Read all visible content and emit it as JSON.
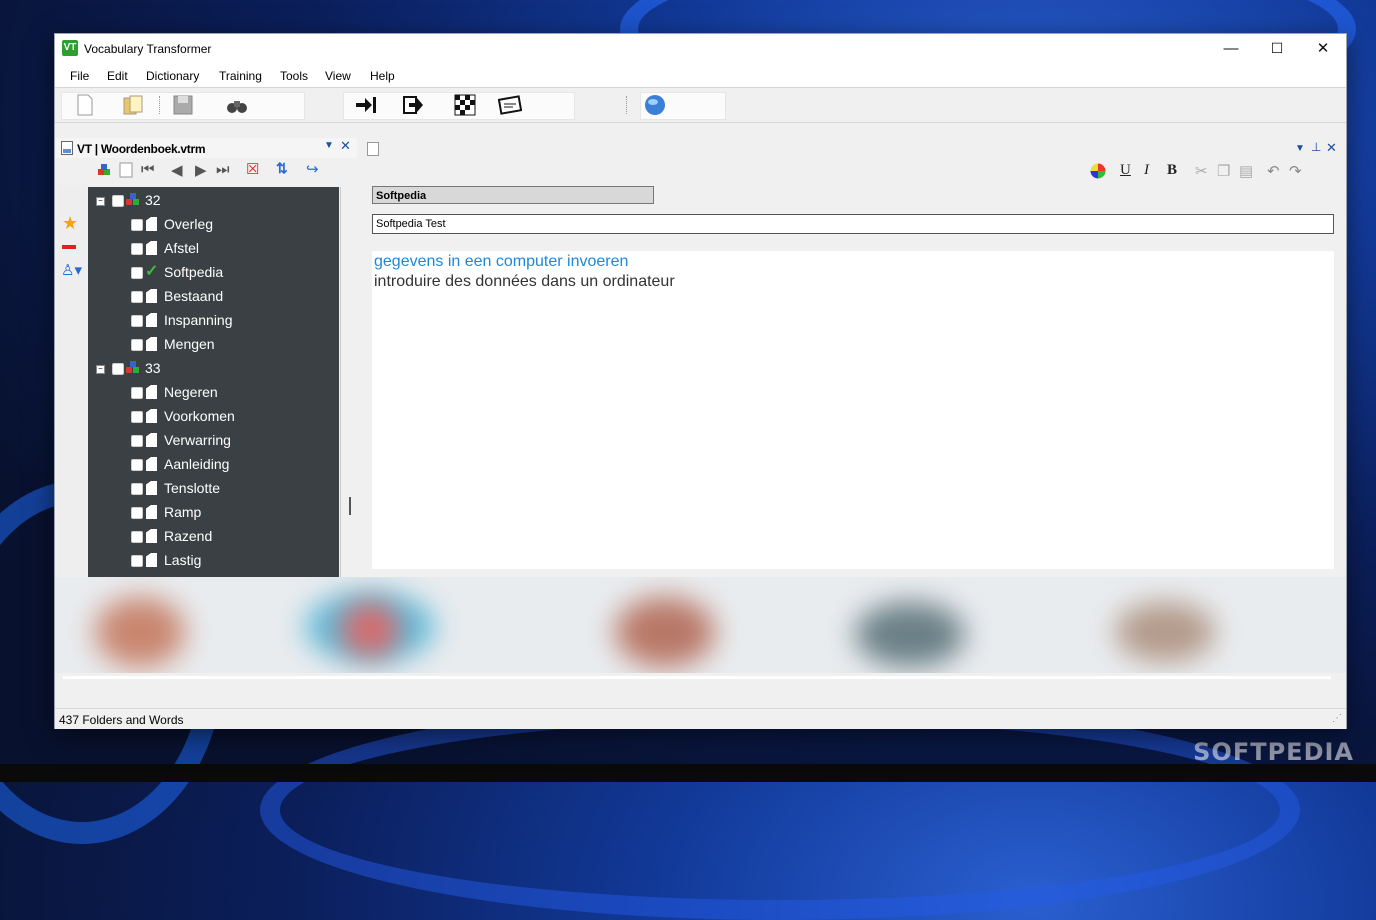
{
  "window": {
    "title": "Vocabulary Transformer",
    "logo_text": "VT",
    "controls": {
      "minimize": "—",
      "maximize": "☐",
      "close": "✕"
    }
  },
  "menu": [
    "File",
    "Edit",
    "Dictionary",
    "Training",
    "Tools",
    "View",
    "Help"
  ],
  "left_panel": {
    "title": "VT | Woordenboek.vtrm",
    "tree": [
      {
        "type": "folder",
        "label": "32"
      },
      {
        "type": "word",
        "label": "Overleg"
      },
      {
        "type": "word",
        "label": "Afstel"
      },
      {
        "type": "word",
        "label": "Softpedia",
        "checked_icon": true
      },
      {
        "type": "word",
        "label": "Bestaand"
      },
      {
        "type": "word",
        "label": "Inspanning"
      },
      {
        "type": "word",
        "label": "Mengen"
      },
      {
        "type": "folder",
        "label": "33"
      },
      {
        "type": "word",
        "label": "Negeren"
      },
      {
        "type": "word",
        "label": "Voorkomen"
      },
      {
        "type": "word",
        "label": "Verwarring"
      },
      {
        "type": "word",
        "label": "Aanleiding"
      },
      {
        "type": "word",
        "label": "Tenslotte"
      },
      {
        "type": "word",
        "label": "Ramp"
      },
      {
        "type": "word",
        "label": "Razend"
      },
      {
        "type": "word",
        "label": "Lastig"
      }
    ]
  },
  "editor": {
    "word_field": "Softpedia",
    "note_field": "Softpedia Test",
    "content_line_1": "gegevens in een computer invoeren",
    "content_line_2": "introduire des données dans un ordinateur",
    "format_buttons": {
      "underline": "U",
      "italic": "I",
      "bold": "B"
    }
  },
  "status": {
    "text": "437 Folders and Words"
  },
  "watermark": "SOFTPEDIA",
  "colors": {
    "tree_bg": "#3a4043",
    "link_blue": "#1e88d8",
    "logo_green": "#2f9e2f"
  }
}
